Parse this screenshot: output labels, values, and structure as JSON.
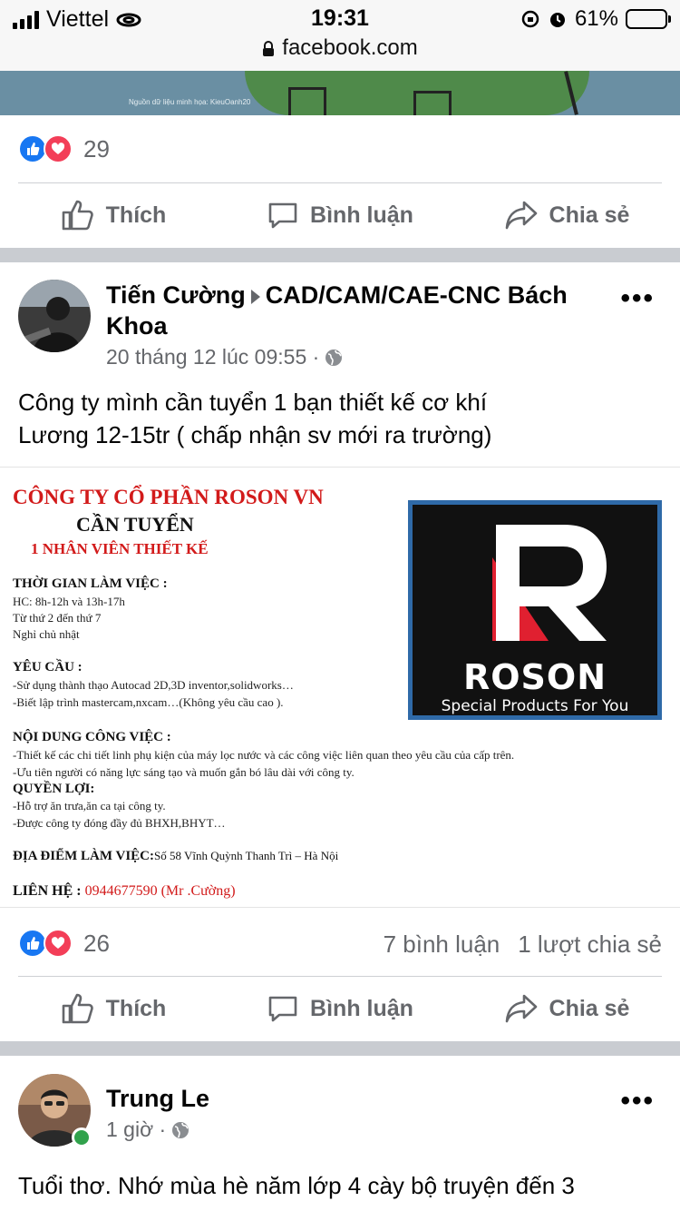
{
  "status_bar": {
    "carrier": "Viettel",
    "time": "19:31",
    "battery": "61%",
    "battery_level": 0.61,
    "url": "facebook.com"
  },
  "previous_post": {
    "image_credit": "Nguồn dữ liệu minh họa: KieuOanh20",
    "reaction_count": "29",
    "actions": {
      "like": "Thích",
      "comment": "Bình luận",
      "share": "Chia sẻ"
    }
  },
  "post": {
    "author": "Tiến Cường",
    "group_line1": "CAD/CAM/CAE-CNC Bách",
    "group_line2": "Khoa",
    "timestamp": "20 tháng 12 lúc 09:55 ·",
    "text_line1": "Công ty mình cần tuyển 1 bạn thiết kế cơ khí",
    "text_line2": "Lương 12-15tr ( chấp nhận sv mới ra trường)",
    "reaction_count": "26",
    "comments": "7 bình luận",
    "shares": "1 lượt chia sẻ",
    "actions": {
      "like": "Thích",
      "comment": "Bình luận",
      "share": "Chia sẻ"
    }
  },
  "poster": {
    "company": "CÔNG TY CỔ PHẦN ROSON VN",
    "hiring": "CẦN TUYỂN",
    "position": "1 NHÂN VIÊN THIẾT KẾ",
    "work_time_title": "THỜI GIAN LÀM VIỆC :",
    "work_time_lines": [
      "HC: 8h-12h  và 13h-17h",
      "Từ thứ 2 đến thứ 7",
      "Nghỉ chủ nhật"
    ],
    "requirements_title": "YÊU CẦU :",
    "requirements_lines": [
      "-Sử dụng thành thạo Autocad 2D,3D inventor,solidworks…",
      "-Biết lập trình mastercam,nxcam…(Không yêu cầu cao )."
    ],
    "duties_title": "NỘI DUNG CÔNG VIỆC :",
    "duties_lines": [
      "-Thiết kế các chi tiết linh phụ kiện của máy lọc nước và các công việc liên quan theo yêu cầu của cấp trên.",
      "-Ưu tiên người có năng lực sáng tạo và muốn gắn bó lâu dài với công ty."
    ],
    "benefits_title": "QUYỀN LỢI:",
    "benefits_lines": [
      "-Hỗ trợ ăn trưa,ăn ca tại công ty.",
      "-Được công ty đóng đầy đủ BHXH,BHYT…"
    ],
    "location_title": "ĐỊA ĐIỂM LÀM VIỆC:",
    "location_value": "Số 58 Vĩnh Quỳnh Thanh Trì – Hà Nội",
    "contact_title": "LIÊN HỆ :",
    "contact_value": "0944677590 (Mr .Cường)",
    "logo_word": "ROSON",
    "logo_tagline": "Special Products For You"
  },
  "next_post": {
    "author": "Trung Le",
    "timestamp": "1 giờ ·",
    "text_line1": "Tuổi thơ. Nhớ mùa hè năm lớp 4 cày bộ truyện đến 3"
  },
  "colors": {
    "facebook_blue": "#1877f2",
    "love_red": "#f33e58",
    "secondary_text": "#65676b",
    "poster_red": "#d21a1a",
    "logo_frame": "#2f6aa8"
  },
  "icons": {
    "signal": "signal-bars-icon",
    "wifi": "wifi-icon",
    "lock": "lock-icon",
    "alarm": "alarm-icon",
    "rotation_lock": "rotation-lock-icon",
    "battery": "battery-icon",
    "like": "thumbs-up-icon",
    "love": "heart-icon",
    "comment": "comment-bubble-icon",
    "share": "share-arrow-icon",
    "globe": "globe-icon",
    "more": "more-dots-icon"
  }
}
